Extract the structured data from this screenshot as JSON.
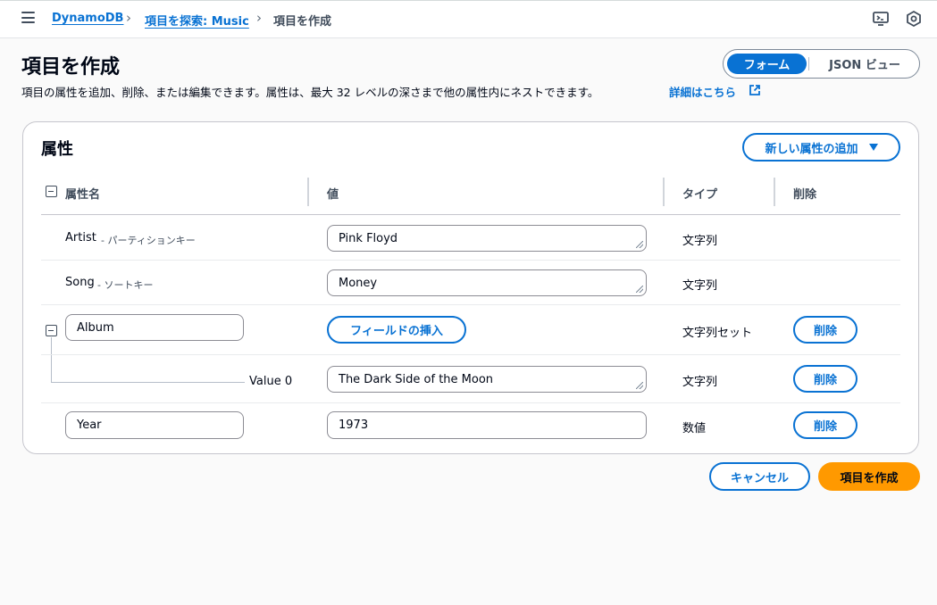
{
  "breadcrumb": {
    "items": [
      "DynamoDB",
      "項目を探索: Music"
    ],
    "current": "項目を作成"
  },
  "header": {
    "title": "項目を作成",
    "description": "項目の属性を追加、削除、または編集できます。属性は、最大 32 レベルの深さまで他の属性内にネストできます。",
    "learn_more": "詳細はこちら",
    "view_toggle": {
      "form": "フォーム",
      "json": "JSON ビュー",
      "selected": "フォーム"
    }
  },
  "attributes": {
    "title": "属性",
    "add_button": "新しい属性の追加",
    "columns": {
      "name": "属性名",
      "value": "値",
      "type": "タイプ",
      "delete": "削除"
    },
    "rows": [
      {
        "name": "Artist",
        "sub": "- パーティションキー",
        "value": "Pink Floyd",
        "type": "文字列"
      },
      {
        "name": "Song",
        "sub": "- ソートキー",
        "value": "Money",
        "type": "文字列"
      },
      {
        "name": "Album",
        "value_button": "フィールドの挿入",
        "type": "文字列セット",
        "delete": "削除"
      },
      {
        "name": "Value 0",
        "value": "The Dark Side of the Moon",
        "type": "文字列",
        "delete": "削除"
      },
      {
        "name": "Year",
        "value": "1973",
        "type": "数値",
        "delete": "削除"
      }
    ]
  },
  "footer": {
    "cancel": "キャンセル",
    "create": "項目を作成"
  },
  "colors": {
    "accent": "#0972d3",
    "primary": "#ff9900"
  }
}
